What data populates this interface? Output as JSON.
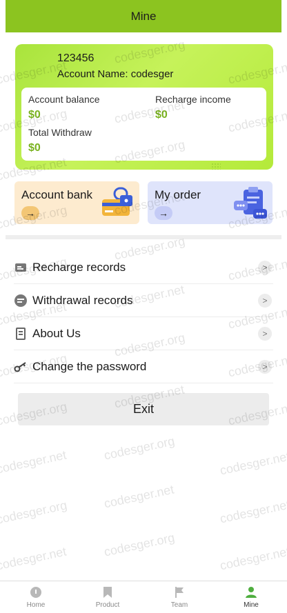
{
  "header": {
    "title": "Mine"
  },
  "profile": {
    "uid": "123456",
    "account_name": "Account Name: codesger"
  },
  "balance": {
    "account_balance_label": "Account balance",
    "account_balance_value": "$0",
    "recharge_income_label": "Recharge income",
    "recharge_income_value": "$0",
    "total_withdraw_label": "Total Withdraw",
    "total_withdraw_value": "$0"
  },
  "tiles": {
    "bank_label": "Account bank",
    "order_label": "My order",
    "arrow": "→"
  },
  "menu": {
    "items": [
      {
        "label": "Recharge records",
        "icon": "receipt-icon"
      },
      {
        "label": "Withdrawal records",
        "icon": "withdraw-icon"
      },
      {
        "label": "About Us",
        "icon": "document-icon"
      },
      {
        "label": "Change the password",
        "icon": "key-icon"
      }
    ],
    "chevron": ">"
  },
  "exit_label": "Exit",
  "tabbar": {
    "tabs": [
      {
        "label": "Home",
        "icon": "home-icon"
      },
      {
        "label": "Product",
        "icon": "bookmark-icon"
      },
      {
        "label": "Team",
        "icon": "flag-icon"
      },
      {
        "label": "Mine",
        "icon": "person-icon"
      }
    ],
    "active_index": 3
  },
  "watermark": "codesger.org",
  "watermark_alt": "codesger.net",
  "colors": {
    "accent": "#8cc420",
    "value_green": "#79b21f",
    "bank_tile": "#fdebcf",
    "order_tile": "#dfe4fb",
    "active_tab": "#4fae3f"
  }
}
